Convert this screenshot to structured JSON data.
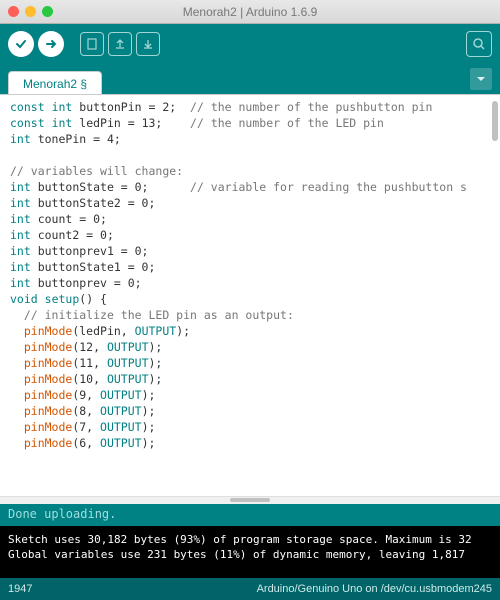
{
  "window": {
    "title": "Menorah2 | Arduino 1.6.9"
  },
  "tabs": {
    "active": "Menorah2 §"
  },
  "code": {
    "lines": [
      {
        "t": "decl",
        "type": "const int",
        "name": "buttonPin",
        "val": "2",
        "trail": ";",
        "comment": "// the number of the pushbutton pin"
      },
      {
        "t": "decl",
        "type": "const int",
        "name": "ledPin",
        "val": "13",
        "trail": ";",
        "comment": "// the number of the LED pin"
      },
      {
        "t": "decl",
        "type": "int",
        "name": "tonePin",
        "val": "4",
        "trail": ";"
      },
      {
        "t": "blank"
      },
      {
        "t": "comment",
        "text": "// variables will change:"
      },
      {
        "t": "decl",
        "type": "int",
        "name": "buttonState",
        "val": "0",
        "trail": ";",
        "comment": "// variable for reading the pushbutton s"
      },
      {
        "t": "decl",
        "type": "int",
        "name": "buttonState2",
        "val": "0",
        "trail": ";"
      },
      {
        "t": "decl",
        "type": "int",
        "name": "count",
        "val": "0",
        "trail": ";"
      },
      {
        "t": "decl",
        "type": "int",
        "name": "count2",
        "val": "0",
        "trail": ";"
      },
      {
        "t": "decl",
        "type": "int",
        "name": "buttonprev1",
        "val": "0",
        "trail": ";"
      },
      {
        "t": "decl",
        "type": "int",
        "name": "buttonState1",
        "val": "0",
        "trail": ";"
      },
      {
        "t": "decl",
        "type": "int",
        "name": "buttonprev",
        "val": "0",
        "trail": ";"
      },
      {
        "t": "funcdef",
        "ret": "void",
        "name": "setup",
        "sig": "()",
        "brace": " {"
      },
      {
        "t": "comment",
        "indent": 1,
        "text": "// initialize the LED pin as an output:"
      },
      {
        "t": "call",
        "indent": 1,
        "fn": "pinMode",
        "args": [
          "ledPin",
          "OUTPUT"
        ]
      },
      {
        "t": "call",
        "indent": 1,
        "fn": "pinMode",
        "args": [
          "12",
          "OUTPUT"
        ]
      },
      {
        "t": "call",
        "indent": 1,
        "fn": "pinMode",
        "args": [
          "11",
          "OUTPUT"
        ]
      },
      {
        "t": "call",
        "indent": 1,
        "fn": "pinMode",
        "args": [
          "10",
          "OUTPUT"
        ]
      },
      {
        "t": "call",
        "indent": 1,
        "fn": "pinMode",
        "args": [
          "9",
          "OUTPUT"
        ]
      },
      {
        "t": "call",
        "indent": 1,
        "fn": "pinMode",
        "args": [
          "8",
          "OUTPUT"
        ]
      },
      {
        "t": "call",
        "indent": 1,
        "fn": "pinMode",
        "args": [
          "7",
          "OUTPUT"
        ]
      },
      {
        "t": "call",
        "indent": 1,
        "fn": "pinMode",
        "args": [
          "6",
          "OUTPUT"
        ]
      }
    ]
  },
  "status": {
    "text": "Done uploading."
  },
  "console": {
    "lines": [
      "Sketch uses 30,182 bytes (93%) of program storage space. Maximum is 32",
      "Global variables use 231 bytes (11%) of dynamic memory, leaving 1,817 "
    ]
  },
  "footer": {
    "line": "1947",
    "board": "Arduino/Genuino Uno on /dev/cu.usbmodem245"
  }
}
